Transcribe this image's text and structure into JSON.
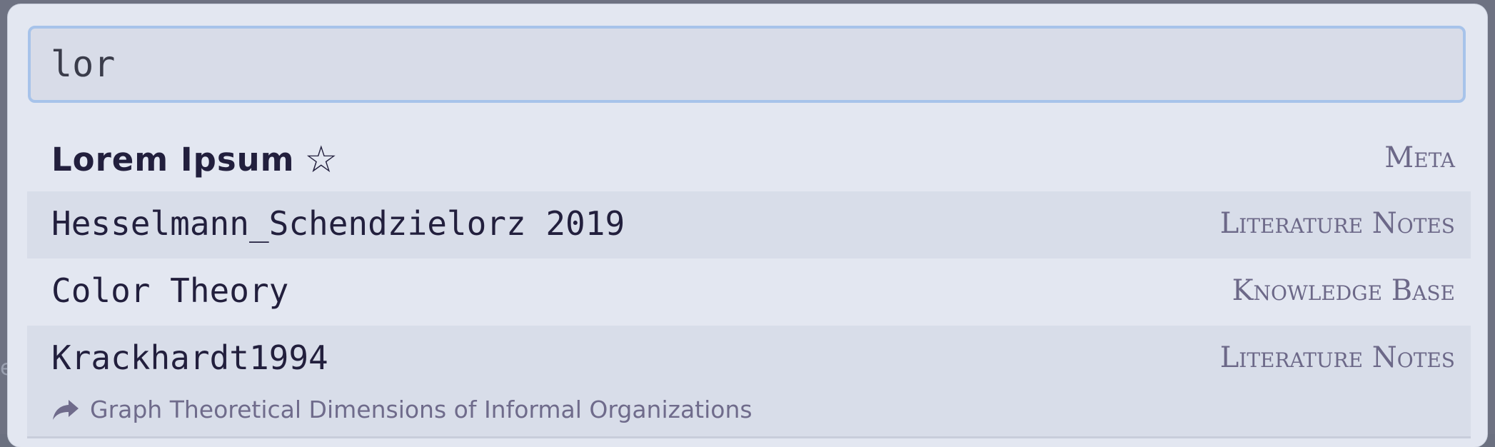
{
  "search": {
    "value": "lor",
    "placeholder": ""
  },
  "results": [
    {
      "title": "Lorem Ipsum",
      "starred": true,
      "category": "Meta",
      "alias": ""
    },
    {
      "title": "Hesselmann_Schendzielorz 2019",
      "starred": false,
      "category": "Literature Notes",
      "alias": ""
    },
    {
      "title": "Color Theory",
      "starred": false,
      "category": "Knowledge Base",
      "alias": ""
    },
    {
      "title": "Krackhardt1994",
      "starred": false,
      "category": "Literature Notes",
      "alias": "Graph Theoretical Dimensions of Informal Organizations"
    }
  ],
  "icons": {
    "star": "star-icon",
    "alias": "share-arrow-icon"
  },
  "colors": {
    "modal_bg": "#e3e7f1",
    "input_border": "#a7c3ea",
    "title_text": "#221f3d",
    "category_text": "#6c6888",
    "alt_row_bg": "#d8dde9"
  }
}
